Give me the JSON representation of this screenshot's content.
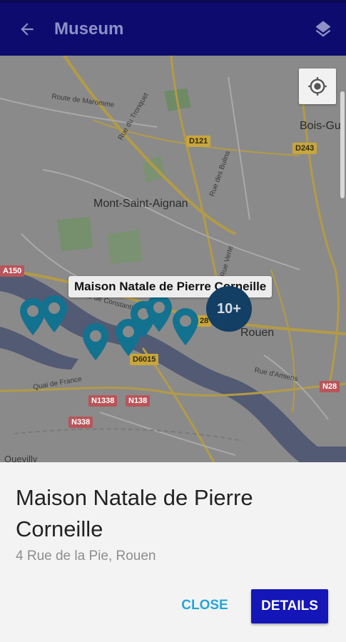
{
  "appbar": {
    "title": "Museum",
    "back_icon": "arrow-back-icon",
    "layers_icon": "layers-icon",
    "color": "#0d0c6e"
  },
  "map": {
    "labels": {
      "town_mont_saint_aignan": "Mont-Saint-Aignan",
      "town_rouen": "Rouen",
      "town_bois_gu": "Bois-Gu",
      "town_quevilly": "Quevilly",
      "street_route_maromme": "Route de Maromme",
      "street_rue_du_tronquet": "Rue du Tronquet",
      "street_rue_des_bulins": "Rue des Bulins",
      "street_rue_verte": "Rue Verte",
      "street_quai_de_france": "Quai de France",
      "street_rue_d_amiens": "Rue d'Amiens",
      "street_rue_constantine": "Rue de Constantine"
    },
    "roads": {
      "d121": "D121",
      "d243": "D243",
      "a150": "A150",
      "d6015": "D6015",
      "n1338": "N1338",
      "n138": "N138",
      "n338": "N338",
      "n28": "N28",
      "d28": "28"
    },
    "selected_marker_title": "Maison Natale de Pierre Corneille",
    "cluster_label": "10+",
    "locate_icon": "my-location-icon",
    "pin_color": "#13728f"
  },
  "sheet": {
    "name": "Maison Natale de Pierre Corneille",
    "address": "4 Rue de la Pie, Rouen",
    "close_label": "CLOSE",
    "details_label": "DETAILS",
    "accent": "#1416b8",
    "close_color": "#23a6d8"
  }
}
